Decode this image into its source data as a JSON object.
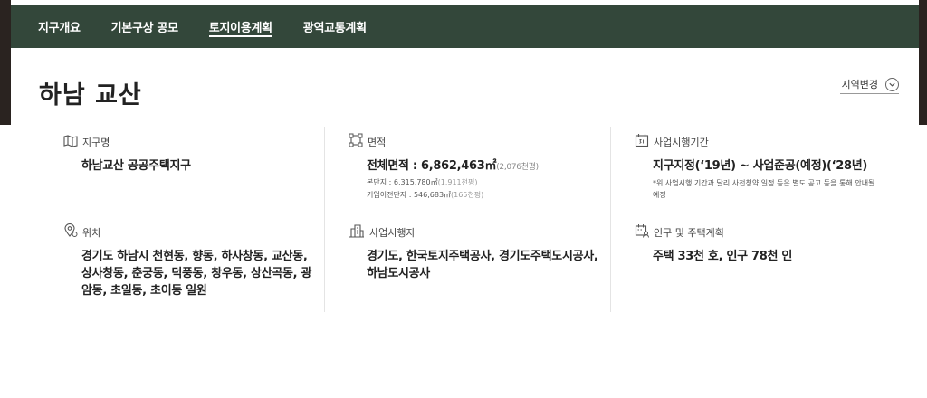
{
  "nav": {
    "tabs": [
      {
        "label": "지구개요"
      },
      {
        "label": "기본구상 공모"
      },
      {
        "label": "토지이용계획"
      },
      {
        "label": "광역교통계획"
      }
    ],
    "active_index": 2
  },
  "header": {
    "title": "하남 교산",
    "region_change_label": "지역변경"
  },
  "info": {
    "district_name": {
      "label": "지구명",
      "value": "하남교산 공공주택지구"
    },
    "area": {
      "label": "면적",
      "value_prefix": "전체면적 : ",
      "value": "6,862,463㎡",
      "value_sub": "(2,076천평)",
      "sub1_label": "본단지 : ",
      "sub1_value": "6,315,780㎡",
      "sub1_paren": "(1,911천평)",
      "sub2_label": "기업이전단지 : ",
      "sub2_value": "546,683㎡",
      "sub2_paren": "(165천평)"
    },
    "period": {
      "label": "사업시행기간",
      "value": "지구지정(‘19년) ~ 사업준공(예정)(‘28년)",
      "note": "*위 사업시행 기간과 달리 사전청약 일정 등은 별도 공고 등을 통해 안내될 예정"
    },
    "location": {
      "label": "위치",
      "value": "경기도 하남시 천현동, 향동, 하사창동, 교산동, 상사창동, 춘궁동, 덕풍동, 창우동, 상산곡동, 광암동, 초일동, 초이동 일원"
    },
    "operator": {
      "label": "사업시행자",
      "value": "경기도, 한국토지주택공사, 경기도주택도시공사, 하남도시공사"
    },
    "population": {
      "label": "인구 및 주택계획",
      "value": "주택 33천 호, 인구 78천 인"
    }
  }
}
